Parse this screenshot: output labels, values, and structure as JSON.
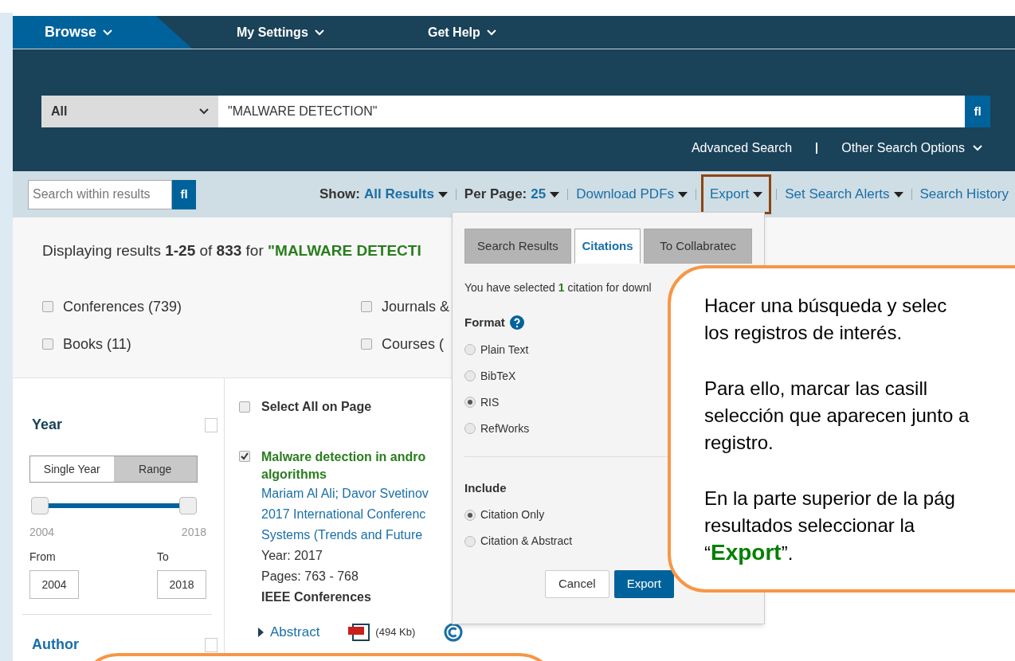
{
  "nav": [
    {
      "label": "Browse",
      "selected": true
    },
    {
      "label": "My Settings",
      "selected": false
    },
    {
      "label": "Get Help",
      "selected": false
    }
  ],
  "search": {
    "scope": "All",
    "value": "\"MALWARE DETECTION\"",
    "button": "fl",
    "links": [
      {
        "label": "Advanced Search",
        "dropdown": false
      },
      {
        "label": "Other Search Options",
        "dropdown": true
      }
    ]
  },
  "toolbar": {
    "search_within": {
      "placeholder": "Search within results",
      "button": "fl"
    },
    "items": [
      {
        "label": "Show:",
        "value": "All Results",
        "dropdown": true,
        "highlighted": false
      },
      {
        "label": "Per Page:",
        "value": "25",
        "dropdown": true,
        "highlighted": false
      },
      {
        "value": "Download PDFs",
        "dropdown": true,
        "highlighted": false
      },
      {
        "value": "Export",
        "dropdown": true,
        "highlighted": true
      },
      {
        "value": "Set Search Alerts",
        "dropdown": true,
        "highlighted": false
      },
      {
        "value": "Search History",
        "dropdown": false,
        "highlighted": false
      }
    ]
  },
  "summary": {
    "text": "Displaying results **1-25** of **833** for",
    "query": "\"MALWARE DETECTI"
  },
  "filters": [
    {
      "label": "Conferences (739)",
      "checked": false
    },
    {
      "label": "Journals &",
      "checked": false
    },
    {
      "label": "Books (11)",
      "checked": false
    },
    {
      "label": "Courses (",
      "checked": false
    }
  ],
  "sidebar": {
    "year": {
      "title": "Year",
      "checked": false,
      "modes": [
        {
          "label": "Single Year",
          "selected": false
        },
        {
          "label": "Range",
          "selected": true
        }
      ],
      "slider": {
        "level": 1,
        "min_label": "2004",
        "max_label": "2018"
      },
      "from": {
        "label": "From",
        "value": "2004"
      },
      "to": {
        "label": "To",
        "value": "2018"
      }
    },
    "author": {
      "title": "Author",
      "checked": false
    }
  },
  "results": {
    "select_all": {
      "label": "Select All on Page",
      "checked": false
    },
    "items": [
      {
        "checked": true,
        "title_lines": [
          "Malware detection in andro",
          "algorithms"
        ],
        "authors": "Mariam Al Ali; Davor Svetinov",
        "venue_lines": [
          "2017 International Conferenc",
          "Systems (Trends and Future"
        ],
        "year": "Year: 2017",
        "pages": "Pages: 763 - 768",
        "publisher": "IEEE Conferences",
        "abstract": "Abstract",
        "pdf_size": "(494 Kb)"
      }
    ]
  },
  "popup": {
    "tabs": [
      {
        "label": "Search Results",
        "selected": false
      },
      {
        "label": "Citations",
        "selected": true
      },
      {
        "label": "To Collabratec",
        "selected": false
      }
    ],
    "message": "You have selected **1** citation for downl",
    "format": {
      "title": "Format",
      "options": [
        {
          "label": "Plain Text",
          "selected": false
        },
        {
          "label": "BibTeX",
          "selected": false
        },
        {
          "label": "RIS",
          "selected": true
        },
        {
          "label": "RefWorks",
          "selected": false
        }
      ]
    },
    "include": {
      "title": "Include",
      "options": [
        {
          "label": "Citation Only",
          "selected": true
        },
        {
          "label": "Citation & Abstract",
          "selected": false
        }
      ]
    },
    "buttons": [
      {
        "label": "Cancel",
        "kind": "secondary"
      },
      {
        "label": "Export",
        "kind": "primary"
      }
    ]
  },
  "callout": {
    "paragraphs": [
      [
        "Hacer una búsqueda y selec",
        "los registros de interés."
      ],
      [
        "Para ello, marcar las casill",
        "selección que aparecen junto a",
        "registro."
      ],
      [
        "En la parte superior de la pág",
        "resultados seleccionar la",
        "“**Export**”."
      ]
    ]
  }
}
